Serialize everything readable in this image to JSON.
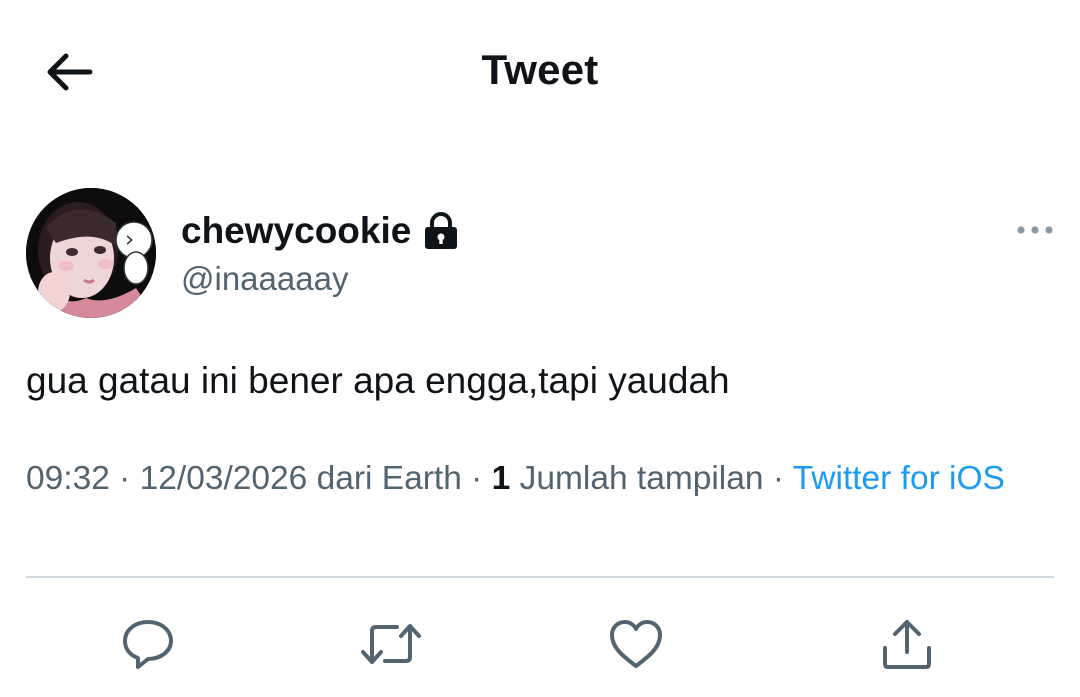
{
  "header": {
    "title": "Tweet"
  },
  "author": {
    "display_name": "chewycookie",
    "handle": "@inaaaaay",
    "protected_icon": "lock-icon"
  },
  "tweet": {
    "text": "gua gatau ini bener apa engga,tapi yaudah"
  },
  "meta": {
    "time": "09:32",
    "separator": " · ",
    "date": "12/03/2026",
    "location": "dari Earth",
    "views_count": "1",
    "views_label": "Jumlah tampilan",
    "source": "Twitter for iOS"
  },
  "icons": {
    "back": "arrow-left-icon",
    "more": "more-horizontal-icon",
    "reply": "reply-bubble-icon",
    "retweet": "retweet-icon",
    "like": "heart-icon",
    "share": "share-upload-icon"
  },
  "colors": {
    "text": "#0f1419",
    "secondary": "#536471",
    "link": "#1d9bf0",
    "divider": "#cfd9de"
  }
}
